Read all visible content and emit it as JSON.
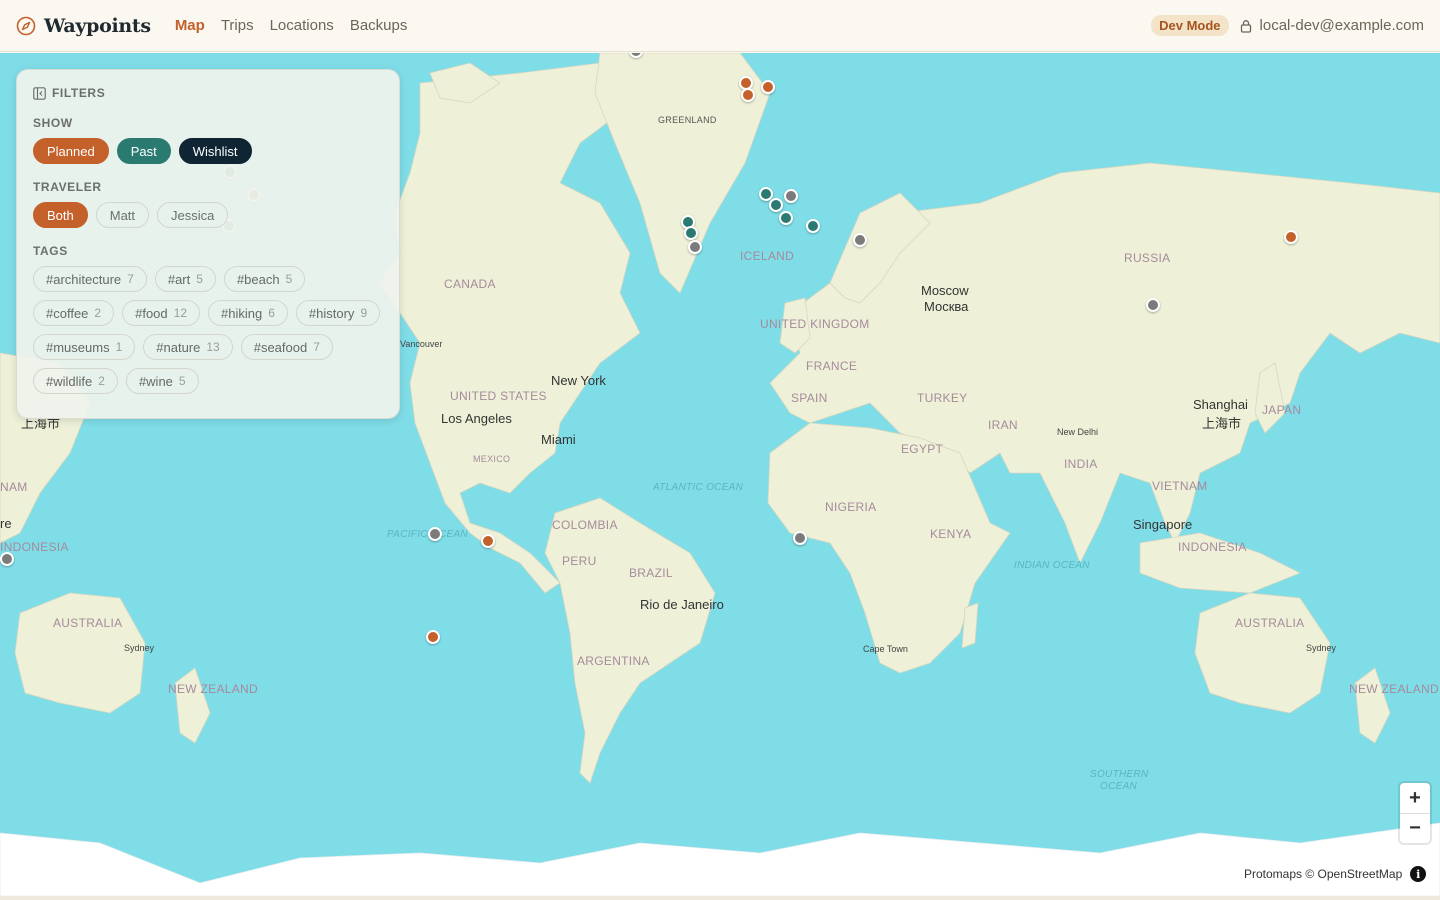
{
  "app": {
    "name": "Waypoints",
    "brand_icon": "compass-icon"
  },
  "nav": {
    "items": [
      "Map",
      "Trips",
      "Locations",
      "Backups"
    ],
    "active": "Map"
  },
  "header": {
    "dev_badge": "Dev Mode",
    "user_email": "local-dev@example.com",
    "user_icon": "lock-icon"
  },
  "filters": {
    "title": "FILTERS",
    "show_label": "SHOW",
    "show": [
      "Planned",
      "Past",
      "Wishlist"
    ],
    "traveler_label": "TRAVELER",
    "traveler": [
      "Both",
      "Matt",
      "Jessica"
    ],
    "traveler_selected": "Both",
    "tags_label": "TAGS",
    "tags": [
      {
        "name": "#architecture",
        "count": "7"
      },
      {
        "name": "#art",
        "count": "5"
      },
      {
        "name": "#beach",
        "count": "5"
      },
      {
        "name": "#coffee",
        "count": "2"
      },
      {
        "name": "#food",
        "count": "12"
      },
      {
        "name": "#hiking",
        "count": "6"
      },
      {
        "name": "#history",
        "count": "9"
      },
      {
        "name": "#museums",
        "count": "1"
      },
      {
        "name": "#nature",
        "count": "13"
      },
      {
        "name": "#seafood",
        "count": "7"
      },
      {
        "name": "#wildlife",
        "count": "2"
      },
      {
        "name": "#wine",
        "count": "5"
      }
    ]
  },
  "colors": {
    "planned": "#c4602a",
    "past": "#2b7a72",
    "wishlist": "#102534",
    "ocean": "#7fdde8",
    "land": "#eef1d8"
  },
  "map": {
    "labels": {
      "greenland": "GREENLAND",
      "iceland": "ICELAND",
      "canada": "CANADA",
      "russia": "RUSSIA",
      "moscow": "Moscow",
      "moscow_cyr": "Москва",
      "uk": "UNITED KINGDOM",
      "france": "FRANCE",
      "spain": "SPAIN",
      "turkey": "TURKEY",
      "iran": "IRAN",
      "egypt": "EGYPT",
      "nigeria": "NIGERIA",
      "kenya": "KENYA",
      "india": "INDIA",
      "new_delhi": "New Delhi",
      "shanghai": "Shanghai",
      "shanghai_cn": "上海市",
      "shanghai_cn_left": "上海市",
      "japan": "JAPAN",
      "vietnam": "VIETNAM",
      "singapore": "Singapore",
      "indonesia": "INDONESIA",
      "indonesia_left": "INDONESIA",
      "australia": "AUSTRALIA",
      "australia_left": "AUSTRALIA",
      "sydney": "Sydney",
      "sydney_left": "Sydney",
      "new_zealand": "NEW ZEALAND",
      "new_zealand_right": "NEW ZEALAND",
      "vancouver": "Vancouver",
      "usa": "UNITED STATES",
      "new_york": "New York",
      "los_angeles": "Los Angeles",
      "mexico": "MEXICO",
      "miami": "Miami",
      "colombia": "COLOMBIA",
      "peru": "PERU",
      "brazil": "BRAZIL",
      "rio": "Rio de Janeiro",
      "argentina": "ARGENTINA",
      "cape_town": "Cape Town",
      "atlantic": "ATLANTIC OCEAN",
      "pacific": "PACIFIC OCEAN",
      "indian": "INDIAN OCEAN",
      "southern": "SOUTHERN",
      "southern2": "OCEAN",
      "nam_left": "NAM",
      "re_left": "re"
    },
    "zoom_in": "+",
    "zoom_out": "−",
    "attribution": "Protomaps © OpenStreetMap",
    "info": "i"
  },
  "pins": [
    {
      "id": "norway-north",
      "status": "planned",
      "lon": 19.0,
      "lat": 69.7
    },
    {
      "id": "norway-lofoten",
      "status": "wishlist",
      "lon": 14.6,
      "lat": 68.2
    },
    {
      "id": "iceland",
      "status": "wishlist",
      "lon": -21.9,
      "lat": 64.1
    },
    {
      "id": "norway-bergen",
      "status": "planned",
      "lon": 5.3,
      "lat": 60.4
    },
    {
      "id": "norway-west",
      "status": "planned",
      "lon": 5.7,
      "lat": 58.9
    },
    {
      "id": "oslo",
      "status": "planned",
      "lon": 10.7,
      "lat": 59.9
    },
    {
      "id": "portland",
      "status": "wishlist",
      "lon": -116.2,
      "lat": 43.6
    },
    {
      "id": "seattle",
      "status": "past",
      "lon": -122.3,
      "lat": 47.6
    },
    {
      "id": "sf",
      "status": "past",
      "lon": -122.4,
      "lat": 37.8
    },
    {
      "id": "lisbon",
      "status": "past",
      "lon": -9.1,
      "lat": 38.7
    },
    {
      "id": "madrid",
      "status": "past",
      "lon": -8.5,
      "lat": 36.5
    },
    {
      "id": "seville",
      "status": "wishlist",
      "lon": -7.5,
      "lat": 33.6
    },
    {
      "id": "italy-north",
      "status": "past",
      "lon": 10.0,
      "lat": 43.8
    },
    {
      "id": "italy-rome",
      "status": "past",
      "lon": 12.5,
      "lat": 41.9
    },
    {
      "id": "italy-south",
      "status": "past",
      "lon": 15.0,
      "lat": 39.5
    },
    {
      "id": "greece",
      "status": "past",
      "lon": 21.7,
      "lat": 37.9
    },
    {
      "id": "croatia",
      "status": "wishlist",
      "lon": 16.4,
      "lat": 43.5
    },
    {
      "id": "cyprus",
      "status": "wishlist",
      "lon": 33.4,
      "lat": 35.1
    },
    {
      "id": "vietnam",
      "status": "wishlist",
      "lon": 105.8,
      "lat": 21.0
    },
    {
      "id": "chile-north",
      "status": "wishlist",
      "lon": -71.6,
      "lat": -33.0
    },
    {
      "id": "buenos-aires",
      "status": "planned",
      "lon": -58.4,
      "lat": -34.6
    },
    {
      "id": "patagonia",
      "status": "planned",
      "lon": -72.0,
      "lat": -51.7
    },
    {
      "id": "cape-town",
      "status": "wishlist",
      "lon": 18.4,
      "lat": -33.9
    },
    {
      "id": "new-zealand",
      "status": "wishlist",
      "lon": -178.0,
      "lat": -38.0
    },
    {
      "id": "japan-left",
      "status": "planned",
      "lon": 139.7,
      "lat": 35.7
    }
  ]
}
